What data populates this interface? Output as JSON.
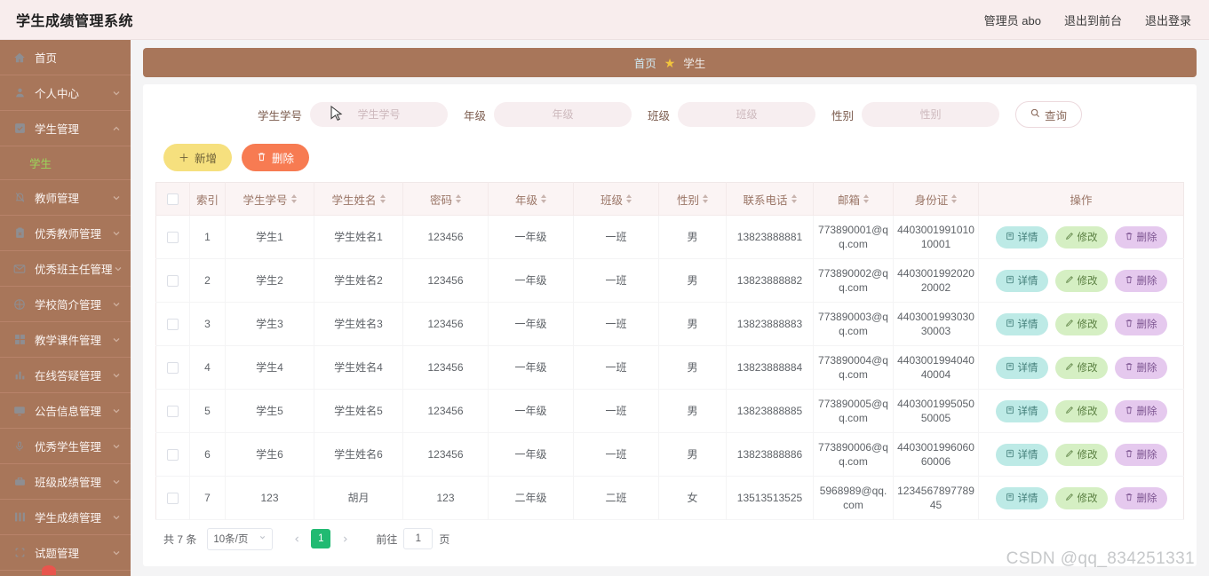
{
  "header": {
    "brand": "学生成绩管理系统",
    "nav": [
      {
        "label": "管理员 abo"
      },
      {
        "label": "退出到前台"
      },
      {
        "label": "退出登录"
      }
    ]
  },
  "sidebar": {
    "items": [
      {
        "label": "首页",
        "icon": "home-icon",
        "arrow": false
      },
      {
        "label": "个人中心",
        "icon": "user-icon",
        "arrow": true
      },
      {
        "label": "学生管理",
        "icon": "check-square-icon",
        "arrow": true,
        "expanded": true,
        "children": [
          {
            "label": "学生",
            "active": true
          }
        ]
      },
      {
        "label": "教师管理",
        "icon": "bell-off-icon",
        "arrow": true
      },
      {
        "label": "优秀教师管理",
        "icon": "clipboard-icon",
        "arrow": true
      },
      {
        "label": "优秀班主任管理",
        "icon": "mail-icon",
        "arrow": true
      },
      {
        "label": "学校简介管理",
        "icon": "compass-icon",
        "arrow": true
      },
      {
        "label": "教学课件管理",
        "icon": "grid-icon",
        "arrow": true
      },
      {
        "label": "在线答疑管理",
        "icon": "bar-chart-icon",
        "arrow": true
      },
      {
        "label": "公告信息管理",
        "icon": "monitor-icon",
        "arrow": true
      },
      {
        "label": "优秀学生管理",
        "icon": "mic-icon",
        "arrow": true
      },
      {
        "label": "班级成绩管理",
        "icon": "briefcase-icon",
        "arrow": true
      },
      {
        "label": "学生成绩管理",
        "icon": "table-icon",
        "arrow": true
      },
      {
        "label": "试题管理",
        "icon": "crop-icon",
        "arrow": true
      }
    ]
  },
  "breadcrumb": {
    "home": "首页",
    "star": "★",
    "current": "学生"
  },
  "search": {
    "fields": [
      {
        "label": "学生学号",
        "placeholder": "学生学号",
        "value": ""
      },
      {
        "label": "年级",
        "placeholder": "年级",
        "value": ""
      },
      {
        "label": "班级",
        "placeholder": "班级",
        "value": ""
      },
      {
        "label": "性别",
        "placeholder": "性别",
        "value": ""
      }
    ],
    "button": "查询",
    "button_icon": "search-icon"
  },
  "toolbar": {
    "add_label": "新增",
    "add_icon": "plus-icon",
    "delete_label": "删除",
    "delete_icon": "trash-icon"
  },
  "table": {
    "columns": [
      {
        "label": "",
        "sortable": false,
        "key": "checkbox"
      },
      {
        "label": "索引",
        "sortable": false
      },
      {
        "label": "学生学号",
        "sortable": true
      },
      {
        "label": "学生姓名",
        "sortable": true
      },
      {
        "label": "密码",
        "sortable": true
      },
      {
        "label": "年级",
        "sortable": true
      },
      {
        "label": "班级",
        "sortable": true
      },
      {
        "label": "性别",
        "sortable": true
      },
      {
        "label": "联系电话",
        "sortable": true
      },
      {
        "label": "邮箱",
        "sortable": true
      },
      {
        "label": "身份证",
        "sortable": true
      },
      {
        "label": "操作",
        "sortable": false
      }
    ],
    "rows": [
      {
        "index": "1",
        "no": "学生1",
        "name": "学生姓名1",
        "password": "123456",
        "grade": "一年级",
        "class": "一班",
        "gender": "男",
        "phone": "13823888881",
        "email": "773890001@qq.com",
        "idcard": "440300199101010001"
      },
      {
        "index": "2",
        "no": "学生2",
        "name": "学生姓名2",
        "password": "123456",
        "grade": "一年级",
        "class": "一班",
        "gender": "男",
        "phone": "13823888882",
        "email": "773890002@qq.com",
        "idcard": "440300199202020002"
      },
      {
        "index": "3",
        "no": "学生3",
        "name": "学生姓名3",
        "password": "123456",
        "grade": "一年级",
        "class": "一班",
        "gender": "男",
        "phone": "13823888883",
        "email": "773890003@qq.com",
        "idcard": "440300199303030003"
      },
      {
        "index": "4",
        "no": "学生4",
        "name": "学生姓名4",
        "password": "123456",
        "grade": "一年级",
        "class": "一班",
        "gender": "男",
        "phone": "13823888884",
        "email": "773890004@qq.com",
        "idcard": "440300199404040004"
      },
      {
        "index": "5",
        "no": "学生5",
        "name": "学生姓名5",
        "password": "123456",
        "grade": "一年级",
        "class": "一班",
        "gender": "男",
        "phone": "13823888885",
        "email": "773890005@qq.com",
        "idcard": "440300199505050005"
      },
      {
        "index": "6",
        "no": "学生6",
        "name": "学生姓名6",
        "password": "123456",
        "grade": "一年级",
        "class": "一班",
        "gender": "男",
        "phone": "13823888886",
        "email": "773890006@qq.com",
        "idcard": "440300199606060006"
      },
      {
        "index": "7",
        "no": "123",
        "name": "胡月",
        "password": "123",
        "grade": "二年级",
        "class": "二班",
        "gender": "女",
        "phone": "13513513525",
        "email": "5968989@qq.com",
        "idcard": "123456789778945"
      }
    ],
    "row_actions": [
      {
        "label": "详情",
        "icon": "doc-icon",
        "style": "op-detail"
      },
      {
        "label": "修改",
        "icon": "pencil-icon",
        "style": "op-edit"
      },
      {
        "label": "删除",
        "icon": "trash-icon",
        "style": "op-del"
      }
    ]
  },
  "pagination": {
    "total": "共 7 条",
    "page_size": "10条/页",
    "prev_icon": "chevron-left-icon",
    "next_icon": "chevron-right-icon",
    "current_page": "1",
    "goto_label": "前往",
    "goto_value": "1",
    "page_unit": "页"
  },
  "watermark": "CSDN @qq_834251331",
  "colors": {
    "sidebar": "#a8765a",
    "topbar": "#f8eded",
    "accent_green": "#21ba72",
    "add_button": "#f6e07e",
    "delete_button": "#f77b52"
  }
}
